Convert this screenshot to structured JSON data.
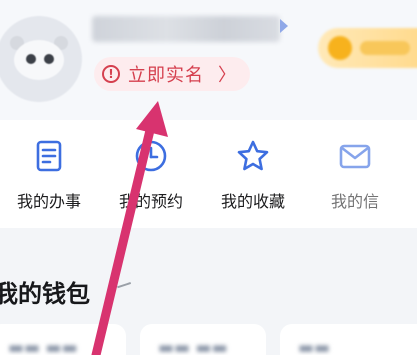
{
  "profile": {
    "realname_label": "立即实名",
    "warn_glyph": "!",
    "chevron": "〉"
  },
  "actions": [
    {
      "label": "我的办事",
      "icon": "document-icon"
    },
    {
      "label": "我的预约",
      "icon": "clock-icon"
    },
    {
      "label": "我的收藏",
      "icon": "star-icon"
    },
    {
      "label": "我的信",
      "icon": "mail-icon"
    }
  ],
  "wallet": {
    "title": "我的钱包"
  },
  "colors": {
    "accent_blue": "#3d6ee0",
    "warning_red": "#d5404f",
    "arrow_pink": "#d8336f"
  }
}
